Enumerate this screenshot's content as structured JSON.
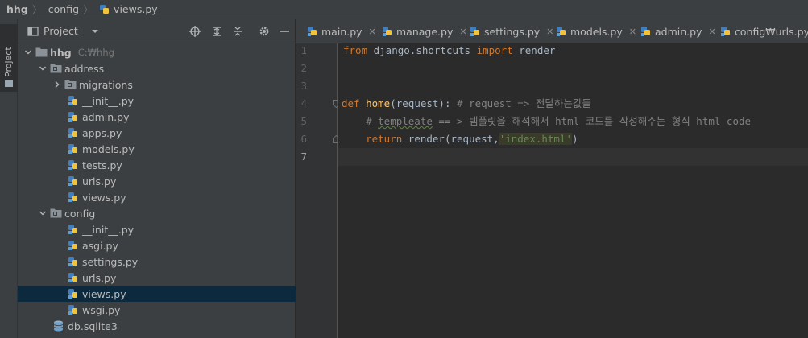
{
  "breadcrumb": {
    "project": "hhg",
    "folder": "config",
    "file": "views.py"
  },
  "tool_strip": {
    "project_tab": "Project"
  },
  "project_panel": {
    "title": "Project",
    "tools": [
      "target-icon",
      "expand-all-icon",
      "collapse-all-icon",
      "gear-icon",
      "minimize-icon"
    ],
    "tree": [
      {
        "label": "hhg",
        "hint": "C:₩hhg",
        "kind": "folder",
        "depth": 0,
        "expanded": true,
        "bold": true
      },
      {
        "label": "address",
        "kind": "package",
        "depth": 1,
        "expanded": true
      },
      {
        "label": "migrations",
        "kind": "package",
        "depth": 2,
        "expanded": false
      },
      {
        "label": "__init__.py",
        "kind": "python",
        "depth": 2
      },
      {
        "label": "admin.py",
        "kind": "python",
        "depth": 2
      },
      {
        "label": "apps.py",
        "kind": "python",
        "depth": 2
      },
      {
        "label": "models.py",
        "kind": "python",
        "depth": 2
      },
      {
        "label": "tests.py",
        "kind": "python",
        "depth": 2
      },
      {
        "label": "urls.py",
        "kind": "python",
        "depth": 2
      },
      {
        "label": "views.py",
        "kind": "python",
        "depth": 2
      },
      {
        "label": "config",
        "kind": "package",
        "depth": 1,
        "expanded": true
      },
      {
        "label": "__init__.py",
        "kind": "python",
        "depth": 2
      },
      {
        "label": "asgi.py",
        "kind": "python",
        "depth": 2
      },
      {
        "label": "settings.py",
        "kind": "python",
        "depth": 2
      },
      {
        "label": "urls.py",
        "kind": "python",
        "depth": 2
      },
      {
        "label": "views.py",
        "kind": "python",
        "depth": 2,
        "selected": true
      },
      {
        "label": "wsgi.py",
        "kind": "python",
        "depth": 2
      },
      {
        "label": "db.sqlite3",
        "kind": "database",
        "depth": 1
      }
    ]
  },
  "editor": {
    "tabs": [
      {
        "label": "main.py"
      },
      {
        "label": "manage.py"
      },
      {
        "label": "settings.py"
      },
      {
        "label": "models.py"
      },
      {
        "label": "admin.py"
      },
      {
        "label": "config₩urls.py"
      }
    ],
    "line_numbers": [
      "1",
      "2",
      "3",
      "4",
      "5",
      "6",
      "7"
    ],
    "current_line": "7",
    "code": {
      "l1_kw1": "from",
      "l1_mod": " django.shortcuts ",
      "l1_kw2": "import",
      "l1_name": " render",
      "l4_kw": "def",
      "l4_sp": " ",
      "l4_fn": "home",
      "l4_params": "(request):",
      "l4_cm": " # request => 전달하는값들",
      "l5_cm_a": "    # ",
      "l5_cm_b": "templeate",
      "l5_cm_c": " == > 템플릿을 해석해서 html 코드를 작성해주는 형식 html code",
      "l6_indent": "    ",
      "l6_kw": "return",
      "l6_call": " render(request,",
      "l6_str": "'index.html'",
      "l6_end": ")"
    }
  },
  "colors": {
    "keyword": "#cc7832",
    "function": "#ffc66d",
    "comment": "#808080",
    "string": "#6a8759",
    "selection": "#0d293e"
  }
}
